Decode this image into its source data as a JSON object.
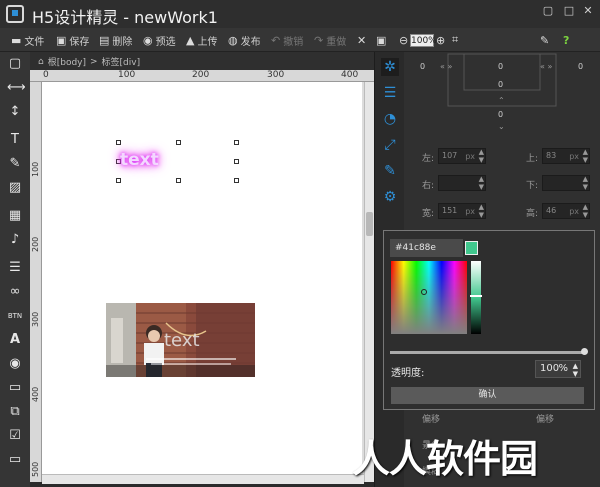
{
  "window": {
    "title": "H5设计精灵 - newWork1",
    "controls": [
      "▢",
      "□",
      "✕"
    ]
  },
  "toolbar": {
    "items": [
      {
        "icon": "folder-icon",
        "glyph": "▬",
        "label": "文件"
      },
      {
        "icon": "save-icon",
        "glyph": "▣",
        "label": "保存"
      },
      {
        "icon": "delete-icon",
        "glyph": "▤",
        "label": "删除"
      },
      {
        "icon": "eye-icon",
        "glyph": "◉",
        "label": "预选"
      },
      {
        "icon": "upload-icon",
        "glyph": "▲",
        "label": "上传"
      },
      {
        "icon": "globe-icon",
        "glyph": "◍",
        "label": "发布"
      },
      {
        "icon": "undo-icon",
        "glyph": "↶",
        "label": "撤销"
      },
      {
        "icon": "redo-icon",
        "glyph": "↷",
        "label": "重做"
      }
    ],
    "zoom": "100%"
  },
  "breadcrumb": {
    "root": "根[body]",
    "separator": ">",
    "current": "标签[div]"
  },
  "ruler": {
    "h_labels": [
      "0",
      "100",
      "200",
      "300",
      "400"
    ],
    "v_labels": [
      "100",
      "200",
      "300",
      "400",
      "500"
    ]
  },
  "canvas": {
    "text_element": "text",
    "image_caption": "text"
  },
  "box_model": {
    "top": "0",
    "left": "0",
    "right": "0",
    "center": "0",
    "bottom": "0",
    "inner_left": "0",
    "inner_right": "0"
  },
  "properties": {
    "left_label": "左:",
    "left_value": "107",
    "unit": "px",
    "top_label": "上:",
    "top_value": "83",
    "right_label": "右:",
    "bottom_label": "下:",
    "width_label": "宽:",
    "width_value": "151",
    "height_label": "高:",
    "height_value": "46",
    "offset_label_1": "偏移",
    "offset_label_2": "偏移",
    "shadow_label": "景色",
    "blur_label": "模糊"
  },
  "color_picker": {
    "hex": "#41c88e",
    "opacity_label": "透明度:",
    "opacity_value": "100",
    "opacity_unit": "%",
    "opacity": 1.0,
    "confirm": "确认",
    "swatch_color": "#41c88e"
  },
  "watermark": "人人软件园"
}
